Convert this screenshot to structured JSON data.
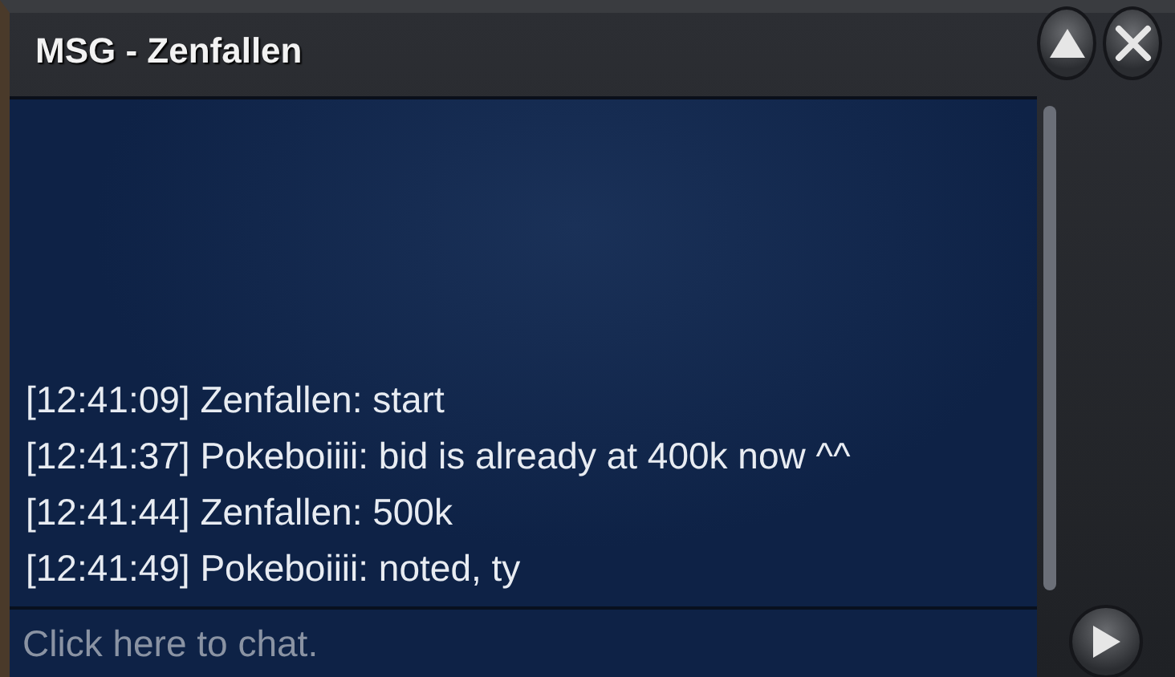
{
  "window": {
    "title": "MSG - Zenfallen"
  },
  "messages": [
    {
      "text": "[12:41:09] Zenfallen: start"
    },
    {
      "text": "[12:41:37] Pokeboiiii: bid is already at 400k now ^^"
    },
    {
      "text": "[12:41:44] Zenfallen: 500k"
    },
    {
      "text": "[12:41:49] Pokeboiiii: noted, ty"
    }
  ],
  "input": {
    "placeholder": "Click here to chat."
  }
}
